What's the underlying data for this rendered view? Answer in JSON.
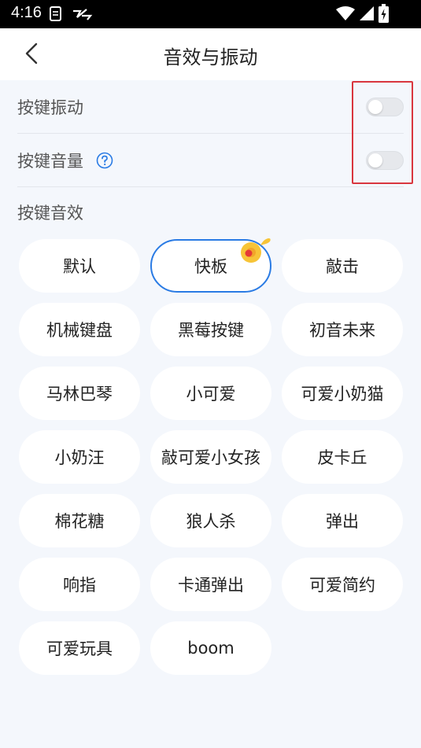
{
  "status_bar": {
    "time": "4:16"
  },
  "header": {
    "title": "音效与振动"
  },
  "settings": {
    "key_vibration": {
      "label": "按键振动",
      "enabled": false
    },
    "key_volume": {
      "label": "按键音量",
      "enabled": false
    }
  },
  "sound_effects": {
    "section_label": "按键音效",
    "selected": "快板",
    "items": [
      "默认",
      "快板",
      "敲击",
      "机械键盘",
      "黑莓按键",
      "初音未来",
      "马林巴琴",
      "小可爱",
      "可爱小奶猫",
      "小奶汪",
      "敲可爱小女孩",
      "皮卡丘",
      "棉花糖",
      "狼人杀",
      "弹出",
      "响指",
      "卡通弹出",
      "可爱简约",
      "可爱玩具",
      "boom"
    ]
  },
  "colors": {
    "accent": "#2a7be4",
    "highlight": "#d9363e",
    "badge": "#f7c437"
  }
}
